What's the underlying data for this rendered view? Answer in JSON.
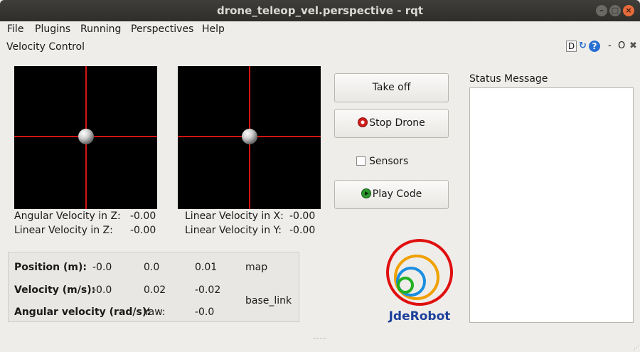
{
  "window": {
    "title": "drone_teleop_vel.perspective - rqt",
    "minimize_icon": "minimize-icon",
    "maximize_icon": "maximize-icon",
    "close_icon": "close-icon"
  },
  "menu": {
    "file": "File",
    "plugins": "Plugins",
    "running": "Running",
    "perspectives": "Perspectives",
    "help": "Help"
  },
  "panel": {
    "title": "Velocity Control",
    "tool_d": "D",
    "tool_reload": "↻",
    "tool_help": "?",
    "tool_dash": "-",
    "tool_o": "O",
    "tool_x": "✖"
  },
  "left_pad": {
    "angular_z_label": "Angular Velocity in Z:",
    "angular_z_value": "-0.00",
    "linear_z_label": "Linear Velocity in Z:",
    "linear_z_value": "-0.00"
  },
  "right_pad": {
    "linear_x_label": "Linear Velocity in X:",
    "linear_x_value": "-0.00",
    "linear_y_label": "Linear Velocity in Y:",
    "linear_y_value": "-0.00"
  },
  "buttons": {
    "take_off": "Take off",
    "stop_drone": "Stop Drone",
    "sensors": "Sensors",
    "play_code": "Play Code"
  },
  "info": {
    "position_label": "Position (m):",
    "position_x": "-0.0",
    "position_y": "0.0",
    "position_z": "0.01",
    "position_frame": "map",
    "velocity_label": "Velocity (m/s):",
    "velocity_x": "-0.0",
    "velocity_y": "0.02",
    "velocity_z": "-0.02",
    "velocity_frame": "base_link",
    "angular_label": "Angular velocity (rad/s):",
    "yaw_label": "Yaw:",
    "yaw_value": "-0.0"
  },
  "logo": {
    "text": "JdeRobot"
  },
  "status": {
    "label": "Status Message",
    "text": ""
  },
  "colors": {
    "crosshair": "#d21414",
    "logo_red": "#e01010",
    "logo_orange": "#f0a000",
    "logo_blue": "#1a8ee0",
    "logo_green": "#22b022",
    "logo_text": "#1b3f9a"
  }
}
